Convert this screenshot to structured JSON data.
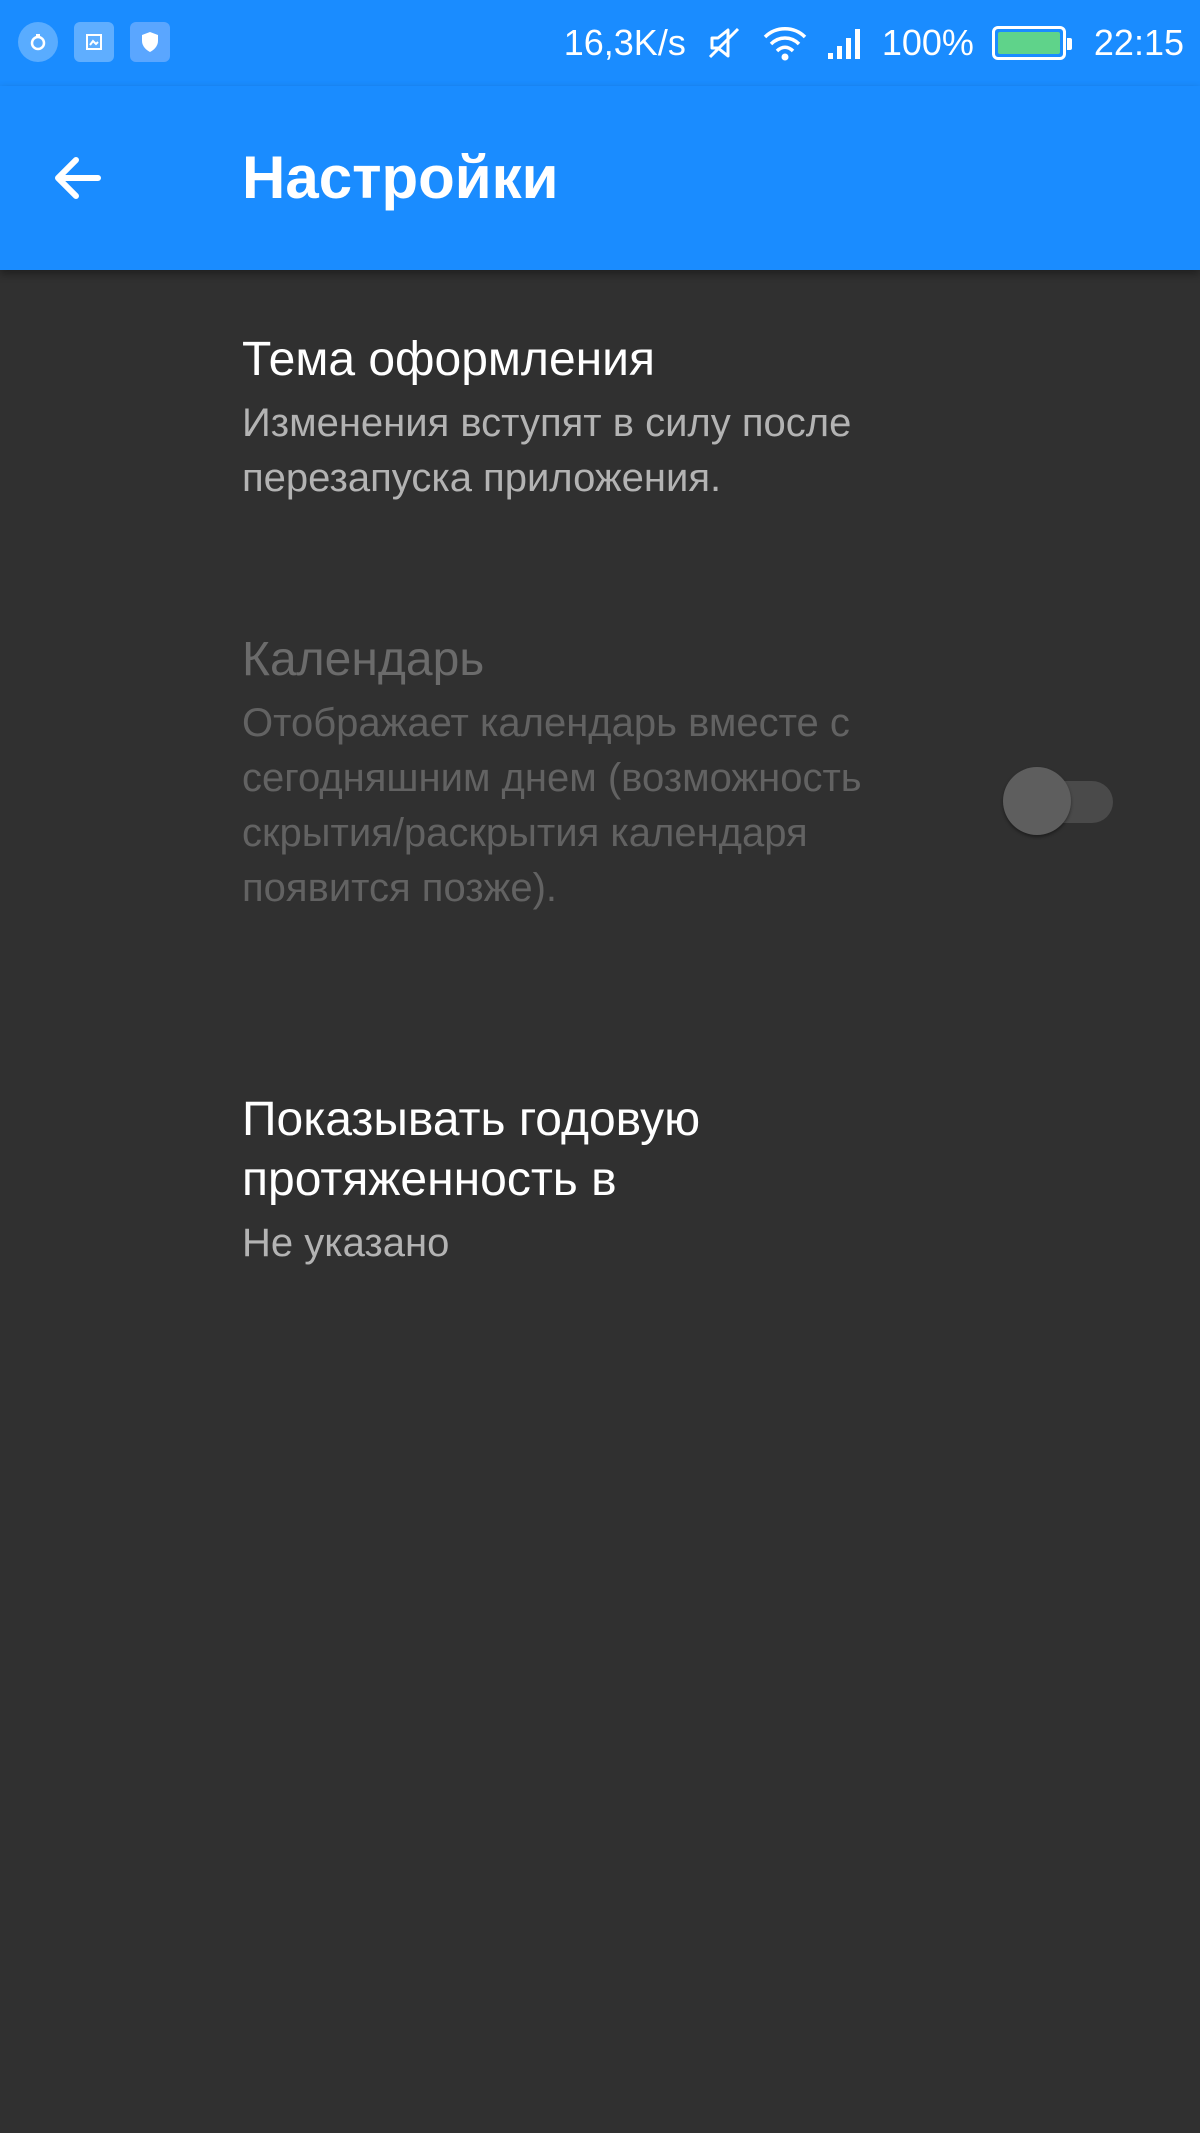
{
  "status_bar": {
    "network_speed": "16,3K/s",
    "battery_percent": "100%",
    "battery_level": 1.0,
    "time": "22:15",
    "icons": [
      "notification-icon",
      "screenshot-icon",
      "shield-icon",
      "mute-icon",
      "wifi-icon",
      "signal-icon",
      "battery-icon"
    ]
  },
  "app_bar": {
    "title": "Настройки",
    "back_icon": "arrow-back-icon"
  },
  "settings": {
    "theme": {
      "title": "Тема оформления",
      "summary": "Изменения вступят в силу после перезапуска приложения."
    },
    "calendar": {
      "title": "Календарь",
      "summary": "Отображает календарь вместе с сегодняшним днем (возможность скрытия/раскрытия календаря появится позже).",
      "enabled": false,
      "checked": false
    },
    "year_length": {
      "title": "Показывать годовую протяженность в",
      "summary": "Не указано"
    }
  },
  "colors": {
    "accent": "#1a8cff",
    "background": "#303030"
  }
}
